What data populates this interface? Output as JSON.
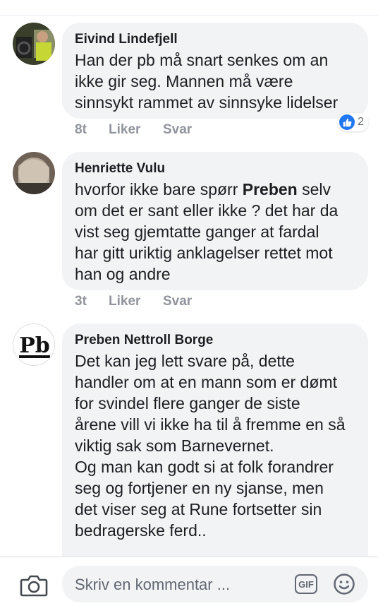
{
  "comments": [
    {
      "author": "Eivind Lindefjell",
      "lines": [
        "Han der pb må snart senkes om an",
        "ikke gir seg. Mannen må være",
        "sinnsykt rammet av sinnsyke lidelser"
      ],
      "time": "8t",
      "like_label": "Liker",
      "reply_label": "Svar",
      "reaction_count": "2"
    },
    {
      "author": "Henriette Vulu",
      "line1_prefix": "hvorfor ikke bare spørr ",
      "line1_bold": "Preben",
      "line1_suffix": " selv",
      "lines": [
        "om det er sant eller ikke ? det har da",
        "vist seg gjemtatte ganger at fardal",
        "har gitt uriktig anklagelser rettet mot",
        "han og andre"
      ],
      "time": "3t",
      "like_label": "Liker",
      "reply_label": "Svar"
    },
    {
      "author": "Preben Nettroll Borge",
      "avatar_text": "Pb",
      "lines": [
        "Det kan jeg lett svare på, dette",
        "handler om at en mann som er dømt",
        "for svindel flere ganger de siste",
        "årene vill vi ikke ha til å fremme en så",
        "viktig sak som Barnevernet.",
        "Og man kan godt si at folk forandrer",
        "seg og fortjener en ny sjanse, men",
        "det viser seg at Rune fortsetter sin",
        "bedragerske ferd.."
      ]
    }
  ],
  "composer": {
    "placeholder": "Skriv en kommentar ...",
    "gif_label": "GIF"
  },
  "icons": {
    "camera": "camera-icon",
    "gif": "gif-icon",
    "emoji": "emoji-icon",
    "like": "thumbs-up-icon"
  },
  "colors": {
    "bubble": "#f2f3f5",
    "action_text": "#90949c",
    "like_blue": "#2078f4"
  }
}
